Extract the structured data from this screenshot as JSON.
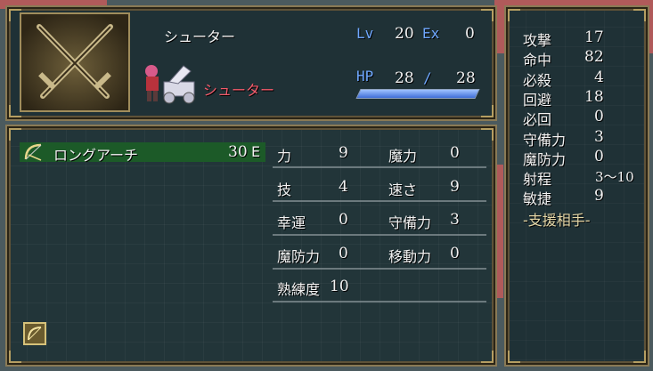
{
  "unit": {
    "name": "シューター",
    "class_name": "シューター",
    "level_label": "Lv",
    "level": "20",
    "exp_label": "Ex",
    "exp": "0",
    "hp_label": "HP",
    "hp_current": "28",
    "hp_sep": "/",
    "hp_max": "28",
    "hp_fraction": 1.0
  },
  "weapon": {
    "icon": "bow-icon",
    "name": "ロングアーチ",
    "uses": "30",
    "rank": "E"
  },
  "stats": [
    {
      "label": "力",
      "value": "9"
    },
    {
      "label": "魔力",
      "value": "0"
    },
    {
      "label": "技",
      "value": "4"
    },
    {
      "label": "速さ",
      "value": "9"
    },
    {
      "label": "幸運",
      "value": "0"
    },
    {
      "label": "守備力",
      "value": "3"
    },
    {
      "label": "魔防力",
      "value": "0"
    },
    {
      "label": "移動力",
      "value": "0"
    },
    {
      "label": "熟練度",
      "value": "10"
    }
  ],
  "battle_stats": [
    {
      "label": "攻撃",
      "value": "17"
    },
    {
      "label": "命中",
      "value": "82"
    },
    {
      "label": "必殺",
      "value": "4"
    },
    {
      "label": "回避",
      "value": "18"
    },
    {
      "label": "必回",
      "value": "0"
    },
    {
      "label": "守備力",
      "value": "3"
    },
    {
      "label": "魔防力",
      "value": "0"
    },
    {
      "label": "射程",
      "value": "3〜10"
    },
    {
      "label": "敏捷",
      "value": "9"
    }
  ],
  "support_label": "-支援相手-",
  "colors": {
    "panel": "#1f3136",
    "border": "#8a7a55",
    "accent_blue": "#6fa8ff",
    "accent_red": "#f25a6a",
    "weapon_highlight": "#1c5a28"
  }
}
